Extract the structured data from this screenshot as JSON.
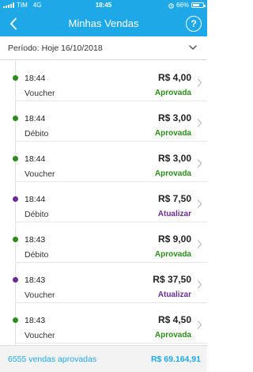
{
  "status_bar": {
    "carrier": "TIM",
    "network": "4G",
    "time": "18:45",
    "battery_text": "66%",
    "battery_level": 0.66
  },
  "header": {
    "title": "Minhas Vendas",
    "help_label": "?"
  },
  "period": {
    "label": "Período: Hoje 16/10/2018"
  },
  "colors": {
    "brand": "#1fa8e8",
    "approved": "#2e8b1e",
    "update": "#6a2c91"
  },
  "transactions": [
    {
      "time": "18:44",
      "type": "Voucher",
      "amount": "R$ 4,00",
      "status": "Aprovada",
      "status_kind": "approved"
    },
    {
      "time": "18:44",
      "type": "Débito",
      "amount": "R$ 3,00",
      "status": "Aprovada",
      "status_kind": "approved"
    },
    {
      "time": "18:44",
      "type": "Voucher",
      "amount": "R$ 3,00",
      "status": "Aprovada",
      "status_kind": "approved"
    },
    {
      "time": "18:44",
      "type": "Débito",
      "amount": "R$ 7,50",
      "status": "Atualizar",
      "status_kind": "update"
    },
    {
      "time": "18:43",
      "type": "Débito",
      "amount": "R$ 9,00",
      "status": "Aprovada",
      "status_kind": "approved"
    },
    {
      "time": "18:43",
      "type": "Voucher",
      "amount": "R$ 37,50",
      "status": "Atualizar",
      "status_kind": "update"
    },
    {
      "time": "18:43",
      "type": "Voucher",
      "amount": "R$ 4,50",
      "status": "Aprovada",
      "status_kind": "approved"
    }
  ],
  "footer": {
    "count_label": "6555 vendas aprovadas",
    "total": "R$ 69.164,91"
  }
}
